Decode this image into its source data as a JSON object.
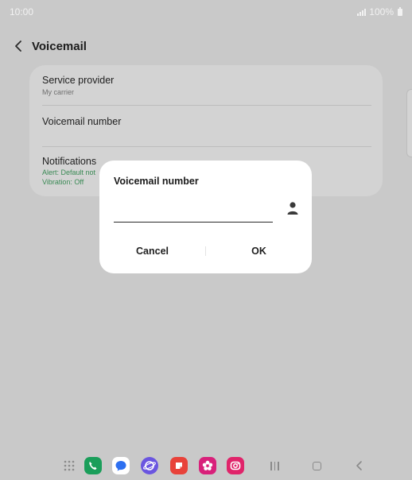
{
  "status_bar": {
    "time": "10:00",
    "battery": "100%"
  },
  "header": {
    "title": "Voicemail"
  },
  "settings": {
    "service_provider": {
      "title": "Service provider",
      "value": "My carrier"
    },
    "voicemail_number": {
      "title": "Voicemail number"
    },
    "notifications": {
      "title": "Notifications",
      "alert": "Alert: Default not",
      "vibration": "Vibration: Off"
    }
  },
  "dialog": {
    "title": "Voicemail number",
    "input_value": "",
    "cancel_label": "Cancel",
    "ok_label": "OK"
  },
  "taskbar": {
    "apps": [
      "app-drawer-icon",
      "phone-icon",
      "messages-icon",
      "internet-icon",
      "notes-icon",
      "gallery-icon",
      "camera-icon"
    ]
  },
  "colors": {
    "phone": "#1a9e5a",
    "messages": "#2d6ff0",
    "internet": "#6a55e0",
    "notes": "#e8423a",
    "gallery": "#d8207a",
    "camera": "#e0246a",
    "green_text": "#3a8a55"
  }
}
